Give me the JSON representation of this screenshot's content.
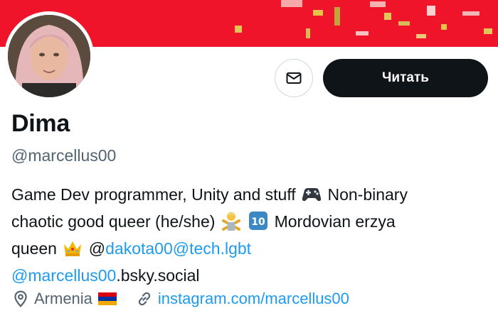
{
  "profile": {
    "display_name": "Dima",
    "handle": "@marcellus00"
  },
  "actions": {
    "message_icon": "envelope-icon",
    "follow_label": "Читать"
  },
  "bio": {
    "line1_text": "Game Dev programmer, Unity and stuff",
    "line1_after": "Non-binary",
    "line2_text": "chaotic good queer (he/she)",
    "line2_after": "Mordovian erzya",
    "line3_text": "queen",
    "line3_at": "@",
    "line3_link": "dakota00@tech.lgbt",
    "line4_link": "@marcellus00",
    "line4_text": ".bsky.social",
    "emoji_1": "gamepad",
    "emoji_2": "person-gesturing-no",
    "emoji_3": "keycap-10",
    "emoji_4": "crown"
  },
  "meta": {
    "location": "Armenia",
    "location_icon": "location-pin-icon",
    "flag": "armenia-flag",
    "website": "instagram.com/marcellus00",
    "website_icon": "link-icon"
  },
  "colors": {
    "banner": "#f0142a",
    "link": "#1d9bf0",
    "button_dark": "#0f1419",
    "muted": "#536471"
  }
}
